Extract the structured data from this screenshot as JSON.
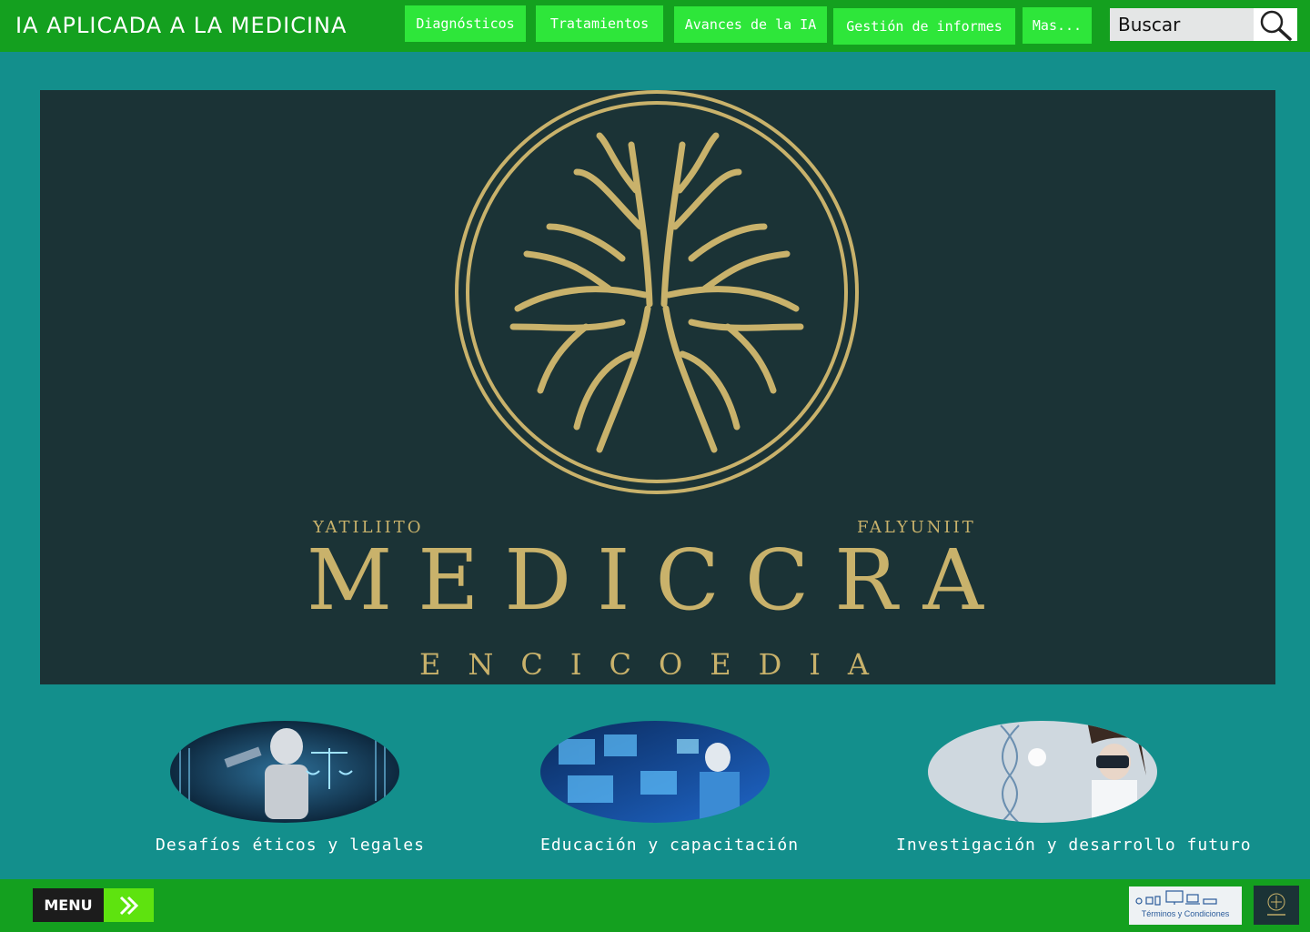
{
  "header": {
    "title": "IA APLICADA A LA MEDICINA",
    "nav": [
      {
        "label": "Diagnósticos"
      },
      {
        "label": "Tratamientos"
      },
      {
        "label": "Avances de la IA"
      },
      {
        "label": "Gestión de informes"
      },
      {
        "label": "Mas..."
      }
    ],
    "search": {
      "placeholder": "Buscar",
      "icon": "magnifier-icon"
    }
  },
  "banner": {
    "left_caption": "YATILIITO",
    "right_caption": "FALYUNIIT",
    "brand": "MEDICCRA",
    "subtitle": "ENCICOEDIA",
    "emblem_icon": "tree-roots-cross-emblem",
    "colors": {
      "background": "#1b3336",
      "gold": "#c9b26b"
    }
  },
  "cards": [
    {
      "label": "Desafíos éticos y legales",
      "image": "robot-with-gavel-and-scales"
    },
    {
      "label": "Educación y capacitación",
      "image": "surgeons-with-holographic-screens"
    },
    {
      "label": "Investigación y desarrollo futuro",
      "image": "woman-with-vr-headset-and-dna"
    }
  ],
  "footer": {
    "menu_label": "MENU",
    "menu_icon": "double-chevron-right-icon",
    "terms_label": "Términos y Condiciones",
    "terms_icons": "devices-icons"
  },
  "colors": {
    "page": "#138f8c",
    "bars": "#14a01f",
    "nav_button": "#2ee63a",
    "menu_arrow": "#5ee30f"
  }
}
